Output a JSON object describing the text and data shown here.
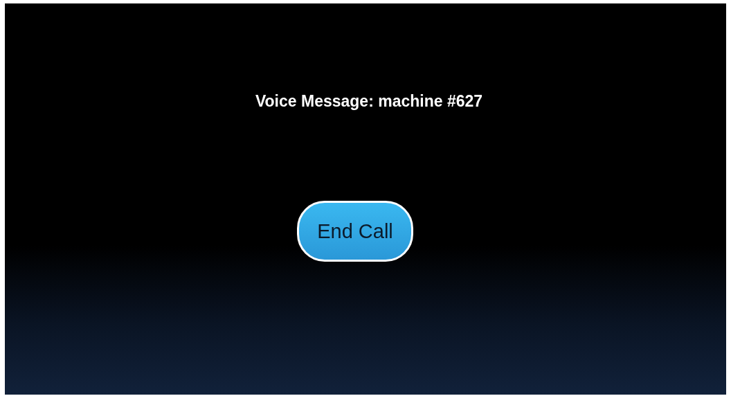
{
  "title": "Voice Message: machine #627",
  "button": {
    "label": "End Call"
  }
}
